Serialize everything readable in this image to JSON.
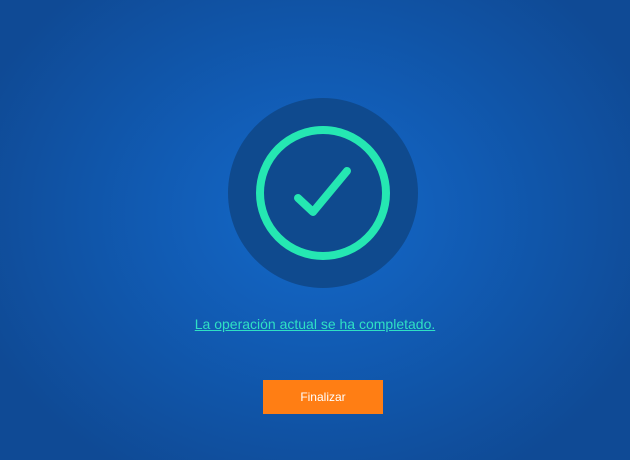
{
  "message": {
    "text": "La operación actual se ha completado."
  },
  "actions": {
    "finish_label": "Finalizar"
  },
  "icons": {
    "status": "check-circle-icon"
  },
  "colors": {
    "background": "#1160bc",
    "badge": "#0f4a8e",
    "success_accent": "#25e7b2",
    "link": "#2fe0c4",
    "button": "#ff7e14",
    "button_text": "#ffffff"
  }
}
